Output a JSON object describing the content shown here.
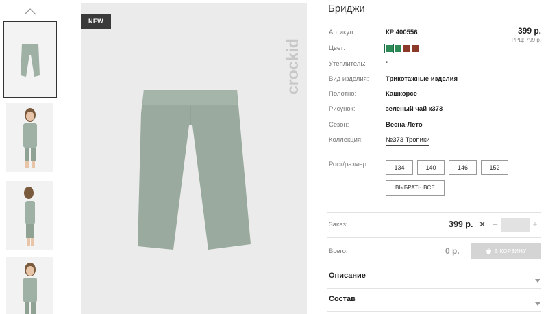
{
  "product": {
    "title": "Бриджи",
    "badge": "NEW",
    "brand": "crockid",
    "price": "399 р.",
    "rrp": "РРЦ: 799 р."
  },
  "details": [
    {
      "label": "Артикул:",
      "value": "КР 400556"
    },
    {
      "label": "Цвет:",
      "value": ""
    },
    {
      "label": "Утеплитель:",
      "value": "\""
    },
    {
      "label": "Вид изделия:",
      "value": "Трикотажные изделия"
    },
    {
      "label": "Полотно:",
      "value": "Кашкорсе"
    },
    {
      "label": "Рисунок:",
      "value": "зеленый чай к373"
    },
    {
      "label": "Сезон:",
      "value": "Весна-Лето"
    },
    {
      "label": "Коллекция:",
      "value": "№373 Тропики"
    }
  ],
  "colors": [
    "#2e8b57",
    "#2e8b57",
    "#8b3a2a",
    "#8b3a2a"
  ],
  "size": {
    "label": "Рост/размер:",
    "options": [
      "134",
      "140",
      "146",
      "152"
    ],
    "select_all": "ВЫБРАТЬ ВСЕ"
  },
  "order": {
    "label": "Заказ:",
    "price": "399 р.",
    "times": "✕",
    "minus": "−",
    "plus": "+",
    "qty": ""
  },
  "total": {
    "label": "Всего:",
    "value": "0 р.",
    "cart_button": "В КОРЗИНУ"
  },
  "accordion": {
    "description": "Описание",
    "composition": "Состав"
  }
}
